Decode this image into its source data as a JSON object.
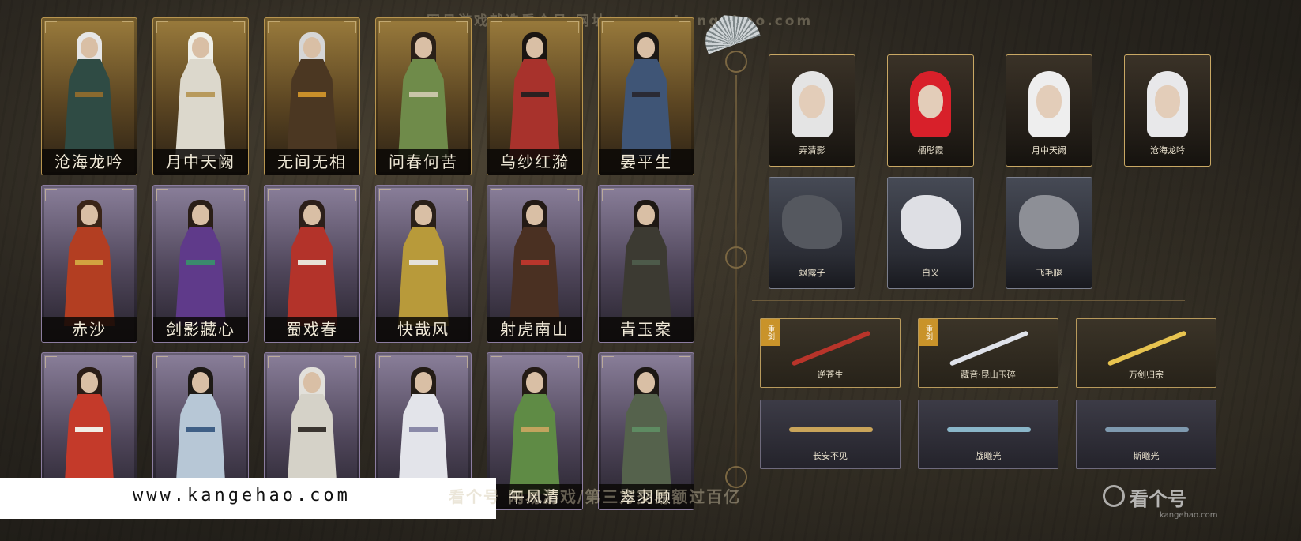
{
  "watermark_top": "网易游戏就选看个号  网址：www.kangehao.com",
  "characters": [
    {
      "name": "沧海龙吟",
      "tier": "gold",
      "hair": "#e6e6e6",
      "robe": "#2f4b44",
      "belt": "#8a6a2f"
    },
    {
      "name": "月中天阙",
      "tier": "gold",
      "hair": "#efefe8",
      "robe": "#dcd8cc",
      "belt": "#b89a5c"
    },
    {
      "name": "无间无相",
      "tier": "gold",
      "hair": "#d6d6d6",
      "robe": "#4b3722",
      "belt": "#c98f2a"
    },
    {
      "name": "问春何苦",
      "tier": "gold",
      "hair": "#2a2018",
      "robe": "#6f8b4a",
      "belt": "#c9c5a8"
    },
    {
      "name": "乌纱红漪",
      "tier": "gold",
      "hair": "#1a1512",
      "robe": "#a8322c",
      "belt": "#2a2020"
    },
    {
      "name": "晏平生",
      "tier": "gold",
      "hair": "#1c1815",
      "robe": "#3f5576",
      "belt": "#2a2a34"
    },
    {
      "name": "赤沙",
      "tier": "purple",
      "hair": "#3a2518",
      "robe": "#b33e22",
      "belt": "#d2a340"
    },
    {
      "name": "剑影藏心",
      "tier": "purple",
      "hair": "#2a1e17",
      "robe": "#5f3a8a",
      "belt": "#3b8a6d"
    },
    {
      "name": "蜀戏春",
      "tier": "purple",
      "hair": "#2c1f1a",
      "robe": "#b3332a",
      "belt": "#e8e2d6"
    },
    {
      "name": "快哉风",
      "tier": "purple",
      "hair": "#2a2018",
      "robe": "#b89a3a",
      "belt": "#e5e2da"
    },
    {
      "name": "射虎南山",
      "tier": "purple",
      "hair": "#231a15",
      "robe": "#4a3022",
      "belt": "#b9362c"
    },
    {
      "name": "青玉案",
      "tier": "purple",
      "hair": "#1e1814",
      "robe": "#3c3a32",
      "belt": "#4d5a4a"
    },
    {
      "name": "",
      "tier": "purple",
      "hair": "#2a1d16",
      "robe": "#c43a2a",
      "belt": "#f0ece4"
    },
    {
      "name": "",
      "tier": "purple",
      "hair": "#1e1a16",
      "robe": "#b7c7d6",
      "belt": "#3f5f86"
    },
    {
      "name": "",
      "tier": "purple",
      "hair": "#e2e0da",
      "robe": "#d5d2c8",
      "belt": "#3a3530"
    },
    {
      "name": "",
      "tier": "purple",
      "hair": "#241c16",
      "robe": "#e3e4ea",
      "belt": "#8a89a8"
    },
    {
      "name": "午风清",
      "tier": "purple",
      "hair": "#241b15",
      "robe": "#5f8b45",
      "belt": "#c2a45e"
    },
    {
      "name": "翠羽顾",
      "tier": "purple",
      "hair": "#1d1814",
      "robe": "#55624c",
      "belt": "#5e8b62"
    }
  ],
  "hairstyles": [
    {
      "name": "弄清影",
      "hair": "#e4e4e4"
    },
    {
      "name": "栖彤霞",
      "hair": "#d8202a"
    },
    {
      "name": "月中天阙",
      "hair": "#eeeeee"
    },
    {
      "name": "沧海龙吟",
      "hair": "#e8e8ea"
    }
  ],
  "mounts": [
    {
      "name": "飒露子",
      "color": "#55585f"
    },
    {
      "name": "白义",
      "color": "#dedfe4"
    },
    {
      "name": "飞毛腿",
      "color": "#8d8f96"
    }
  ],
  "weapons_row1": [
    {
      "name": "逆苍生",
      "tag": "重剑",
      "color": "#b8342a"
    },
    {
      "name": "藏音·昆山玉碎",
      "tag": "重剑",
      "color": "#dfe2ea"
    },
    {
      "name": "万剑归宗",
      "tag": "",
      "color": "#e7c34f"
    }
  ],
  "weapons_row2": [
    {
      "name": "长安不见",
      "color": "#c9a45a"
    },
    {
      "name": "战曦光",
      "color": "#8ab6c9"
    },
    {
      "name": "斯曦光",
      "color": "#7f9ab0"
    }
  ],
  "footer": {
    "url": "www.kangehao.com",
    "watermark": "看个号 网易游戏/第三方交易额过百亿"
  },
  "logo": {
    "main": "看个号",
    "sub": "kangehao.com"
  },
  "colors": {
    "gold_border": "#b8954f",
    "purple_border": "#8c7da0",
    "name_text": "#f1ead8"
  }
}
